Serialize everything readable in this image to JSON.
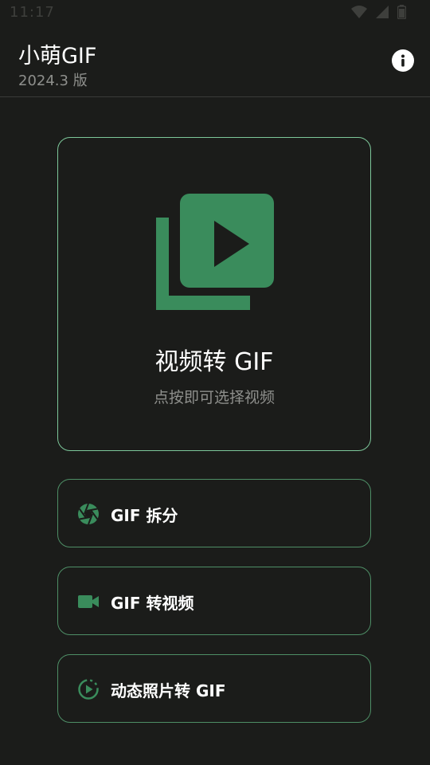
{
  "status_bar": {
    "time": "11:17",
    "icons": [
      "wifi-icon",
      "signal-icon",
      "battery-icon"
    ]
  },
  "header": {
    "title": "小萌GIF",
    "version": "2024.3 版",
    "info_icon": "info-icon"
  },
  "main_card": {
    "icon": "video-library-icon",
    "title": "视频转 GIF",
    "subtitle": "点按即可选择视频"
  },
  "options": [
    {
      "icon": "aperture-icon",
      "label": "GIF 拆分"
    },
    {
      "icon": "videocam-icon",
      "label": "GIF 转视频"
    },
    {
      "icon": "motion-photo-icon",
      "label": "动态照片转 GIF"
    }
  ],
  "colors": {
    "background": "#1b1c1a",
    "accent": "#3a8c5c",
    "card_border": "#7dc79a",
    "secondary_text": "#8e8f8c"
  }
}
